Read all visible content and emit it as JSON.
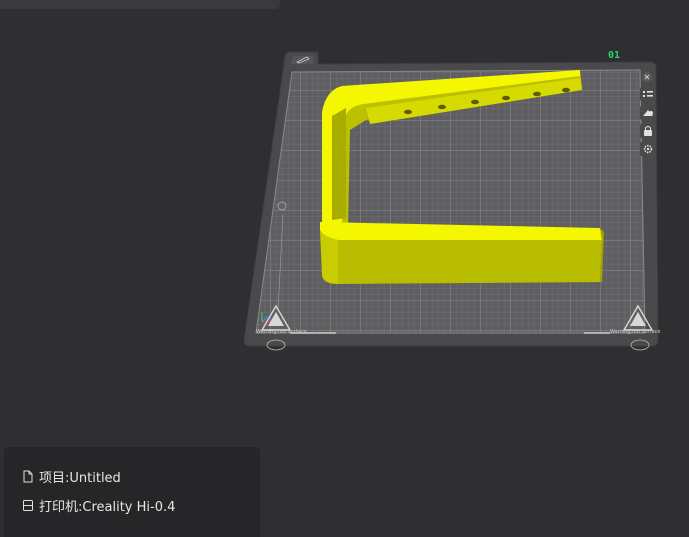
{
  "project": {
    "label": "项目:Untitled"
  },
  "printer": {
    "label": "打印机:Creality Hi-0.4"
  },
  "plate": {
    "number": "01",
    "warning_text": "Warning,hot surface"
  },
  "toolbar": {
    "icons": [
      "list-icon",
      "auto-orient-icon",
      "lock-icon",
      "settings-icon"
    ]
  },
  "colors": {
    "background": "#2f2f31",
    "bed": "#5a5a5d",
    "model": "#eef000",
    "plate_label": "#27d46b"
  }
}
